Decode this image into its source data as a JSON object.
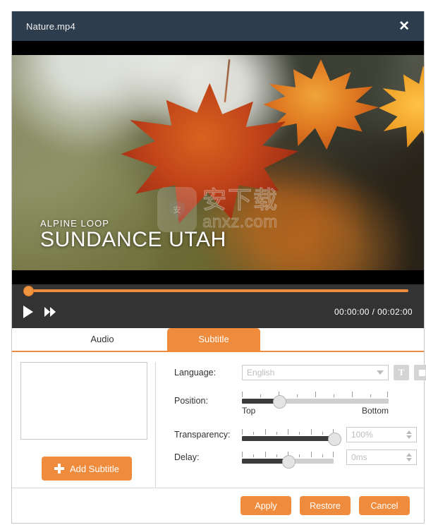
{
  "window": {
    "title": "Nature.mp4",
    "close_icon": "close-icon"
  },
  "video": {
    "caption_small": "ALPINE LOOP",
    "caption_large": "SUNDANCE UTAH",
    "watermark_shield_char": "安",
    "watermark_cn": "安下载",
    "watermark_url": "anxz.com"
  },
  "player": {
    "play_icon": "play-icon",
    "fast_forward_icon": "fast-forward-icon",
    "current_time": "00:00:00",
    "separator": "/",
    "total_time": "00:02:00",
    "progress_percent": 0
  },
  "tabs": [
    {
      "label": "Audio",
      "active": false
    },
    {
      "label": "Subtitle",
      "active": true
    }
  ],
  "subtitle_panel": {
    "list_items": [],
    "add_button_label": "Add Subtitle",
    "language": {
      "label": "Language:",
      "placeholder": "English",
      "value": "",
      "font_button_glyph": "T",
      "color_button_icon": "color-swatch-icon"
    },
    "position": {
      "label": "Position:",
      "start_label": "Top",
      "end_label": "Bottom",
      "value_percent": 25
    },
    "transparency": {
      "label": "Transparency:",
      "value": "100%",
      "value_percent": 100
    },
    "delay": {
      "label": "Delay:",
      "value": "0ms",
      "value_percent": 50
    }
  },
  "footer": {
    "apply_label": "Apply",
    "restore_label": "Restore",
    "cancel_label": "Cancel"
  },
  "colors": {
    "accent": "#ef8b3c",
    "titlebar": "#2e3d4e",
    "player_bg": "#333333"
  }
}
